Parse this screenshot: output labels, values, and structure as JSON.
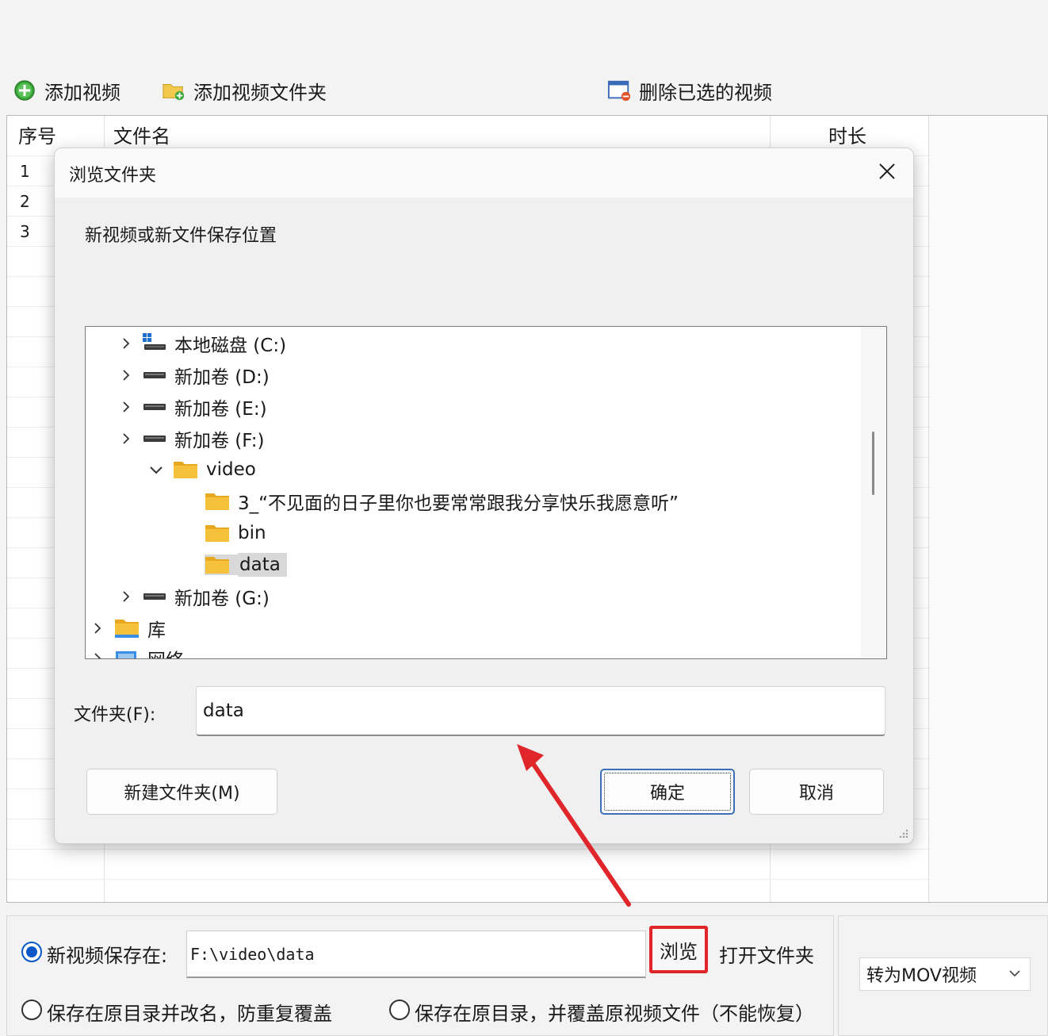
{
  "toolbar": {
    "add_video": "添加视频",
    "add_folder": "添加视频文件夹",
    "delete_selected": "删除已选的视频"
  },
  "table": {
    "headers": {
      "index": "序号",
      "filename": "文件名",
      "duration": "时长"
    },
    "rows": [
      "1",
      "2",
      "3"
    ]
  },
  "dialog": {
    "title": "浏览文件夹",
    "prompt": "新视频或新文件保存位置",
    "tree": [
      {
        "label": "本地磁盘 (C:)",
        "kind": "drive-c",
        "expand": "collapsed"
      },
      {
        "label": "新加卷 (D:)",
        "kind": "drive",
        "expand": "collapsed"
      },
      {
        "label": "新加卷 (E:)",
        "kind": "drive",
        "expand": "collapsed"
      },
      {
        "label": "新加卷 (F:)",
        "kind": "drive",
        "expand": "collapsed"
      },
      {
        "label": "video",
        "kind": "folder",
        "expand": "expanded"
      },
      {
        "label": "3_“不见面的日子里你也要常常跟我分享快乐我愿意听”",
        "kind": "folder",
        "expand": "none"
      },
      {
        "label": "bin",
        "kind": "folder",
        "expand": "none"
      },
      {
        "label": "data",
        "kind": "folder",
        "expand": "none",
        "selected": true
      },
      {
        "label": "新加卷 (G:)",
        "kind": "drive",
        "expand": "collapsed"
      },
      {
        "label": "库",
        "kind": "folder",
        "expand": "collapsed"
      },
      {
        "label": "网络",
        "kind": "network",
        "expand": "collapsed"
      }
    ],
    "folder_label": "文件夹(F):",
    "folder_value": "data",
    "new_folder_button": "新建文件夹(M)",
    "ok_button": "确定",
    "cancel_button": "取消"
  },
  "bottom": {
    "save_in_label": "新视频保存在:",
    "save_path": "F:\\video\\data",
    "browse_button": "浏览",
    "open_folder_button": "打开文件夹",
    "option_rename": "保存在原目录并改名，防重复覆盖",
    "option_overwrite": "保存在原目录，并覆盖原视频文件（不能恢复）",
    "format_select": "转为MOV视频"
  },
  "colors": {
    "accent": "#0a58c8",
    "highlight_red": "#e0252b",
    "folder_yellow": "#f6c23b",
    "primary_border": "#3b6fb6"
  }
}
